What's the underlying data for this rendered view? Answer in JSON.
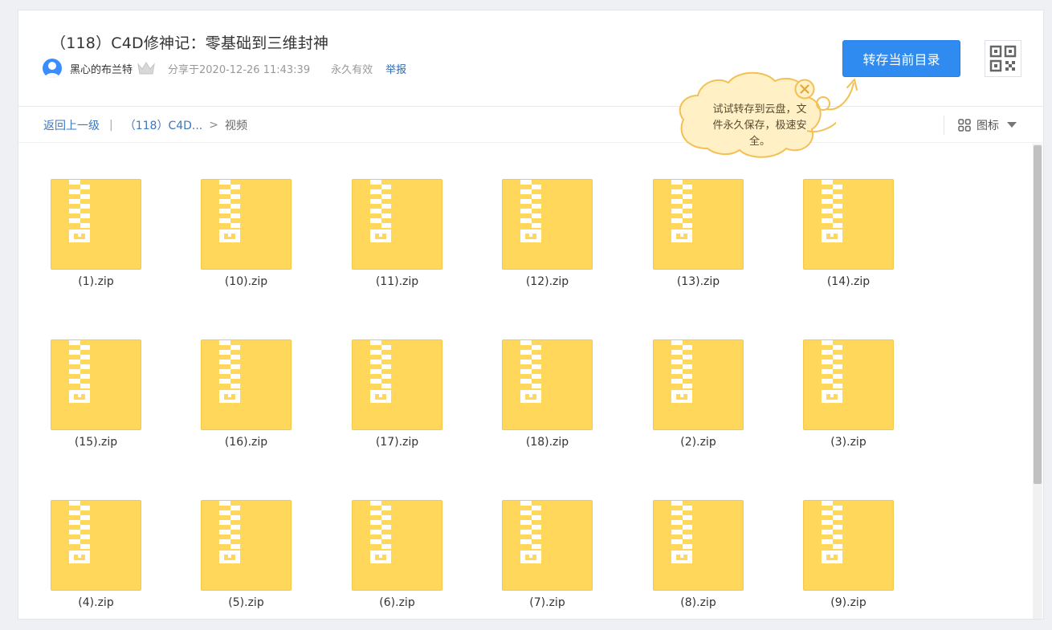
{
  "header": {
    "title": "（118）C4D修神记：零基础到三维封神",
    "username": "黑心的布兰特",
    "share_time": "分享于2020-12-26 11:43:39",
    "validity": "永久有效",
    "report": "举报",
    "save_button": "转存当前目录"
  },
  "breadcrumb": {
    "back": "返回上一级",
    "separator": "|",
    "parent": "（118）C4D...",
    "arrow": ">",
    "current": "视频"
  },
  "view_toggle": {
    "label": "图标"
  },
  "tooltip": {
    "text": "试试转存到云盘，文件永久保存，极速安全。"
  },
  "files": [
    {
      "name": "(1).zip"
    },
    {
      "name": "(10).zip"
    },
    {
      "name": "(11).zip"
    },
    {
      "name": "(12).zip"
    },
    {
      "name": "(13).zip"
    },
    {
      "name": "(14).zip"
    },
    {
      "name": "(15).zip"
    },
    {
      "name": "(16).zip"
    },
    {
      "name": "(17).zip"
    },
    {
      "name": "(18).zip"
    },
    {
      "name": "(2).zip"
    },
    {
      "name": "(3).zip"
    },
    {
      "name": "(4).zip"
    },
    {
      "name": "(5).zip"
    },
    {
      "name": "(6).zip"
    },
    {
      "name": "(7).zip"
    },
    {
      "name": "(8).zip"
    },
    {
      "name": "(9).zip"
    }
  ],
  "colors": {
    "accent": "#2f8bf0",
    "zip_fill": "#ffd75a",
    "link": "#3a78c3"
  }
}
